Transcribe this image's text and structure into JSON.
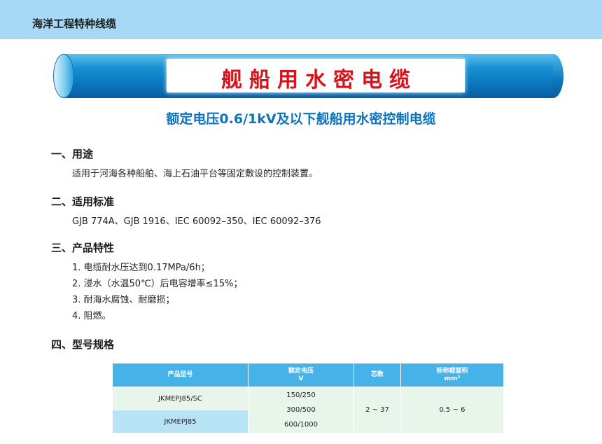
{
  "header": {
    "title": "海洋工程特种线缆"
  },
  "banner": {
    "title": "舰船用水密电缆"
  },
  "subtitle": "额定电压0.6/1kV及以下舰船用水密控制电缆",
  "sections": {
    "use": {
      "heading": "一、用途",
      "text": "适用于河海各种船舶、海上石油平台等固定敷设的控制装置。"
    },
    "standards": {
      "heading": "二、适用标准",
      "text": "GJB 774A、GJB 1916、IEC 60092–350、IEC 60092–376"
    },
    "features": {
      "heading": "三、产品特性",
      "items": [
        "1. 电缆耐水压达到0.17MPa/6h；",
        "2. 浸水（水温50℃）后电容增率≤15%；",
        "3. 耐海水腐蚀、耐磨损；",
        "4. 阻燃。"
      ]
    },
    "models": {
      "heading": "四、型号规格"
    }
  },
  "table": {
    "headers": {
      "model": "产品型号",
      "voltage": "额定电压",
      "voltage_unit": "V",
      "cores": "芯数",
      "section": "标称截面积",
      "section_unit": "mm²"
    },
    "models": [
      "JKMEPJ85/SC",
      "JKMEPJ85"
    ],
    "voltages": [
      "150/250",
      "300/500",
      "600/1000"
    ],
    "cores": "2 ~ 37",
    "section": "0.5 ~ 6"
  }
}
